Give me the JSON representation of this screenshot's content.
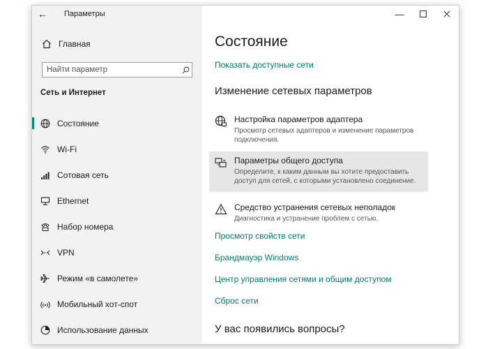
{
  "window": {
    "title": "Параметры",
    "back_icon": "back-arrow-icon",
    "controls": [
      "minimize-icon",
      "maximize-icon",
      "close-icon"
    ]
  },
  "sidebar": {
    "home_label": "Главная",
    "home_icon": "home-icon",
    "search": {
      "placeholder": "Найти параметр",
      "icon": "search-icon"
    },
    "section_title": "Сеть и Интернет",
    "items": [
      {
        "label": "Состояние",
        "icon": "globe-icon",
        "active": true
      },
      {
        "label": "Wi-Fi",
        "icon": "wifi-icon"
      },
      {
        "label": "Сотовая сеть",
        "icon": "signal-bars-icon"
      },
      {
        "label": "Ethernet",
        "icon": "ethernet-icon"
      },
      {
        "label": "Набор номера",
        "icon": "dialup-icon"
      },
      {
        "label": "VPN",
        "icon": "vpn-icon"
      },
      {
        "label": "Режим «в самолете»",
        "icon": "airplane-icon"
      },
      {
        "label": "Мобильный хот-спот",
        "icon": "hotspot-icon"
      },
      {
        "label": "Использование данных",
        "icon": "data-usage-icon"
      }
    ]
  },
  "main": {
    "title": "Состояние",
    "show_networks": "Показать доступные сети",
    "change_heading": "Изменение сетевых параметров",
    "options": [
      {
        "title": "Настройка параметров адаптера",
        "description": "Просмотр сетевых адаптеров и изменение параметров подключения.",
        "icon": "adapter-globe-icon"
      },
      {
        "title": "Параметры общего доступа",
        "description": "Определите, к каким данным вы хотите предоставить доступ для сетей, с которыми установлено соединение.",
        "icon": "sharing-icon"
      },
      {
        "title": "Средство устранения сетевых неполадок",
        "description": "Диагностика и устранение проблем с сетью.",
        "icon": "warning-icon"
      }
    ],
    "links": [
      "Просмотр свойств сети",
      "Брандмауэр Windows",
      "Центр управления сетями и общим доступом",
      "Сброс сети"
    ],
    "questions_heading": "У вас появились вопросы?"
  },
  "colors": {
    "accent": "#00897b",
    "link": "#00796b",
    "sidebar_bg": "#f2f2f2",
    "hover_bg": "#e6e6e6"
  }
}
